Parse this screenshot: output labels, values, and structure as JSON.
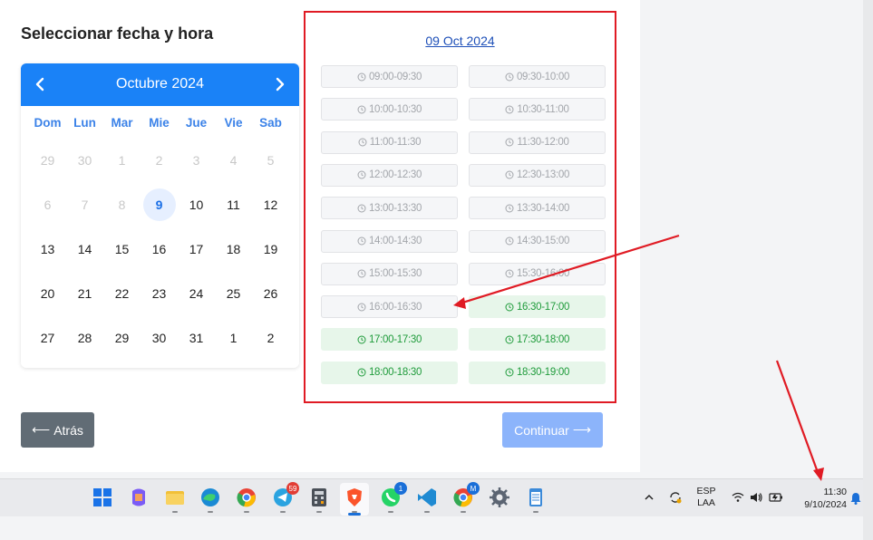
{
  "page": {
    "title": "Seleccionar fecha y hora"
  },
  "calendar": {
    "month_label": "Octubre 2024",
    "weekdays": [
      "Dom",
      "Lun",
      "Mar",
      "Mie",
      "Jue",
      "Vie",
      "Sab"
    ],
    "weeks": [
      [
        {
          "d": "29",
          "muted": true
        },
        {
          "d": "30",
          "muted": true
        },
        {
          "d": "1",
          "muted": true
        },
        {
          "d": "2",
          "muted": true
        },
        {
          "d": "3",
          "muted": true
        },
        {
          "d": "4",
          "muted": true
        },
        {
          "d": "5",
          "muted": true
        }
      ],
      [
        {
          "d": "6",
          "muted": true
        },
        {
          "d": "7",
          "muted": true
        },
        {
          "d": "8",
          "muted": true
        },
        {
          "d": "9",
          "selected": true
        },
        {
          "d": "10"
        },
        {
          "d": "11"
        },
        {
          "d": "12"
        }
      ],
      [
        {
          "d": "13"
        },
        {
          "d": "14"
        },
        {
          "d": "15"
        },
        {
          "d": "16"
        },
        {
          "d": "17"
        },
        {
          "d": "18"
        },
        {
          "d": "19"
        }
      ],
      [
        {
          "d": "20"
        },
        {
          "d": "21"
        },
        {
          "d": "22"
        },
        {
          "d": "23"
        },
        {
          "d": "24"
        },
        {
          "d": "25"
        },
        {
          "d": "26"
        }
      ],
      [
        {
          "d": "27"
        },
        {
          "d": "28"
        },
        {
          "d": "29"
        },
        {
          "d": "30"
        },
        {
          "d": "31"
        },
        {
          "d": "1"
        },
        {
          "d": "2"
        }
      ]
    ]
  },
  "slots": {
    "date_label": "09 Oct 2024",
    "items": [
      {
        "label": "09:00-09:30",
        "available": false
      },
      {
        "label": "09:30-10:00",
        "available": false
      },
      {
        "label": "10:00-10:30",
        "available": false
      },
      {
        "label": "10:30-11:00",
        "available": false
      },
      {
        "label": "11:00-11:30",
        "available": false
      },
      {
        "label": "11:30-12:00",
        "available": false
      },
      {
        "label": "12:00-12:30",
        "available": false
      },
      {
        "label": "12:30-13:00",
        "available": false
      },
      {
        "label": "13:00-13:30",
        "available": false
      },
      {
        "label": "13:30-14:00",
        "available": false
      },
      {
        "label": "14:00-14:30",
        "available": false
      },
      {
        "label": "14:30-15:00",
        "available": false
      },
      {
        "label": "15:00-15:30",
        "available": false
      },
      {
        "label": "15:30-16:00",
        "available": false
      },
      {
        "label": "16:00-16:30",
        "available": false
      },
      {
        "label": "16:30-17:00",
        "available": true
      },
      {
        "label": "17:00-17:30",
        "available": true
      },
      {
        "label": "17:30-18:00",
        "available": true
      },
      {
        "label": "18:00-18:30",
        "available": true
      },
      {
        "label": "18:30-19:00",
        "available": true
      }
    ]
  },
  "buttons": {
    "back": "Atrás",
    "continue": "Continuar"
  },
  "taskbar": {
    "apps": [
      "windows-start-icon",
      "copilot-icon",
      "file-explorer-icon",
      "edge-icon",
      "chrome-icon",
      "telegram-icon",
      "calculator-icon",
      "brave-icon",
      "whatsapp-icon",
      "vscode-icon",
      "chrome-profile-icon",
      "settings-icon",
      "notepad-icon"
    ],
    "telegram_badge": "59",
    "whatsapp_badge": "1",
    "chrome_profile_badge": "M",
    "language": "ESP",
    "keyboard": "LAA",
    "time": "11:30",
    "date": "9/10/2024"
  },
  "colors": {
    "accent": "#1a82f7",
    "available_slot": "#1f9b3b",
    "annotation": "#e01b24"
  }
}
